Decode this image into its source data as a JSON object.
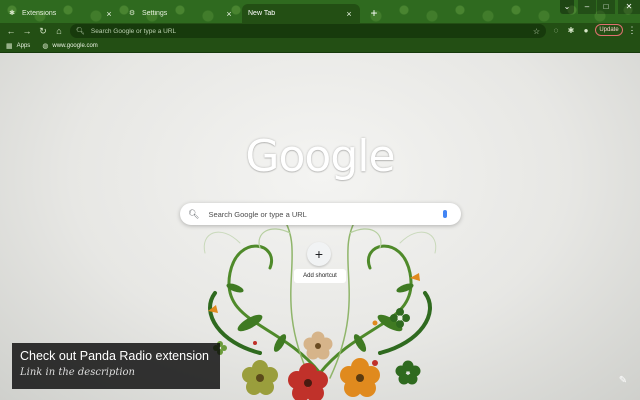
{
  "tabs": [
    {
      "label": "Extensions",
      "icon": "puzzle-icon"
    },
    {
      "label": "Settings",
      "icon": "gear-icon"
    },
    {
      "label": "New Tab",
      "icon": "none",
      "active": true
    }
  ],
  "toolbar": {
    "omnibox_placeholder": "Search Google or type a URL",
    "update_label": "Update"
  },
  "bookmarks": [
    {
      "label": "Apps",
      "icon": "apps-grid-icon"
    },
    {
      "label": "www.google.com",
      "icon": "globe-icon"
    }
  ],
  "page": {
    "logo": "Google",
    "search_placeholder": "Search Google or type a URL",
    "shortcut_label": "Add shortcut",
    "promo_title": "Check out Panda Radio extension",
    "promo_subtitle": "Link in the description"
  },
  "colors": {
    "theme_green": "#2f6a1f",
    "toolbar_green": "#234f14",
    "update_border": "#e07070",
    "mic_blue": "#4285f4"
  }
}
